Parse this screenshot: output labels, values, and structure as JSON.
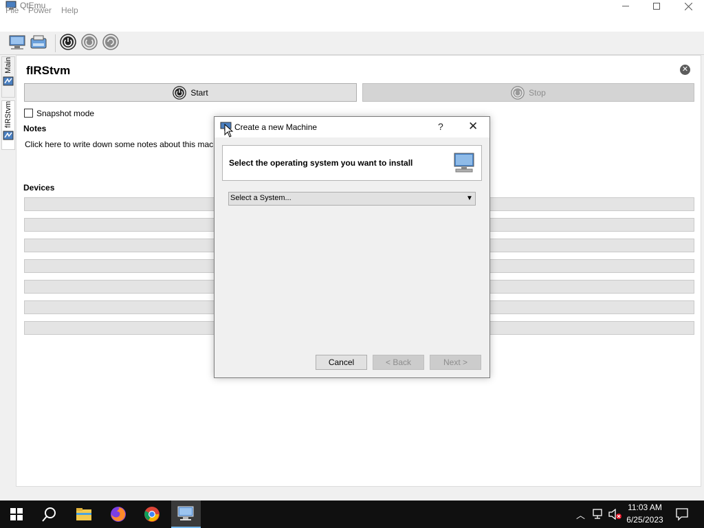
{
  "window": {
    "title": "QtEmu"
  },
  "menu": {
    "items": [
      "File",
      "Power",
      "Help"
    ]
  },
  "sidebar": {
    "tabs": [
      "Main",
      "fIRStvm"
    ]
  },
  "vm": {
    "name": "fIRStvm",
    "start_label": "Start",
    "stop_label": "Stop",
    "snapshot_label": "Snapshot mode",
    "snapshot_checked": false,
    "notes_heading": "Notes",
    "notes_placeholder": "Click here to write down some notes about this machine.",
    "devices_heading": "Devices",
    "device_rows": 7
  },
  "dialog": {
    "title": "Create a new Machine",
    "help_glyph": "?",
    "close_glyph": "✕",
    "header_text": "Select the operating system you want to install",
    "select_value": "Select a System...",
    "cancel_label": "Cancel",
    "back_label": "< Back",
    "next_label": "Next >"
  },
  "taskbar": {
    "time": "11:03 AM",
    "date": "6/25/2023"
  },
  "colors": {
    "accent": "#3c78c8",
    "taskbar": "#101010",
    "panel": "#ffffff",
    "disabled_text": "#8d8d8d"
  },
  "icons": [
    "app-icon",
    "new-machine-icon",
    "open-machine-icon",
    "power-on-icon",
    "shutdown-icon",
    "reset-icon",
    "windows-start-icon",
    "search-icon",
    "file-explorer-icon",
    "firefox-icon",
    "chrome-icon",
    "qtemu-taskbar-icon",
    "network-icon",
    "volume-muted-icon",
    "notifications-icon"
  ]
}
